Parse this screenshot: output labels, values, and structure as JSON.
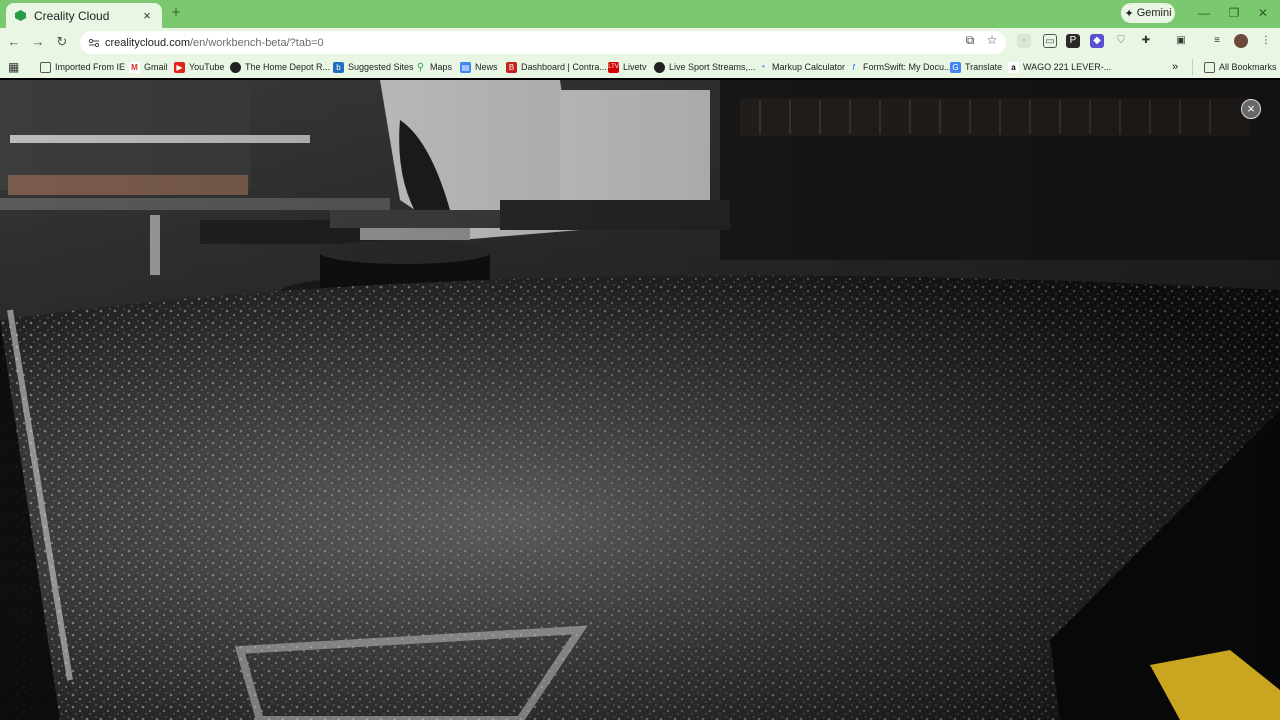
{
  "tab": {
    "title": "Creality Cloud",
    "close": "×"
  },
  "newtab": "+",
  "gemini": {
    "label": "Gemini",
    "icon": "gemini-sparkle-icon"
  },
  "window": {
    "minimize": "—",
    "restore": "❐",
    "close": "✕"
  },
  "url": {
    "host": "crealitycloud.com",
    "path": "/en/workbench-beta/?tab=0"
  },
  "bookmarks": {
    "items": [
      {
        "label": "Imported From IE",
        "icon": "folder-icon"
      },
      {
        "label": "Gmail",
        "icon": "gmail-icon"
      },
      {
        "label": "YouTube",
        "icon": "youtube-icon"
      },
      {
        "label": "The Home Depot R...",
        "icon": "home-depot-icon"
      },
      {
        "label": "Suggested Sites",
        "icon": "suggested-sites-icon"
      },
      {
        "label": "Maps",
        "icon": "maps-icon"
      },
      {
        "label": "News",
        "icon": "news-icon"
      },
      {
        "label": "Dashboard | Contra...",
        "icon": "dashboard-icon"
      },
      {
        "label": "Livetv",
        "icon": "livetv-icon"
      },
      {
        "label": "Live Sport Streams,...",
        "icon": "sport-streams-icon"
      },
      {
        "label": "Markup Calculator",
        "icon": "markup-calculator-icon"
      },
      {
        "label": "FormSwift: My Docu...",
        "icon": "formswift-icon"
      },
      {
        "label": "Translate",
        "icon": "translate-icon"
      },
      {
        "label": "WAGO 221 LEVER-...",
        "icon": "amazon-icon"
      }
    ],
    "overflow": "»",
    "all_bookmarks": "All Bookmarks"
  },
  "content": {
    "description_icon": "camera-feed",
    "close_label": "×"
  },
  "colors": {
    "tabstrip": "#7cc870",
    "toolbar": "#e9f6e4"
  }
}
